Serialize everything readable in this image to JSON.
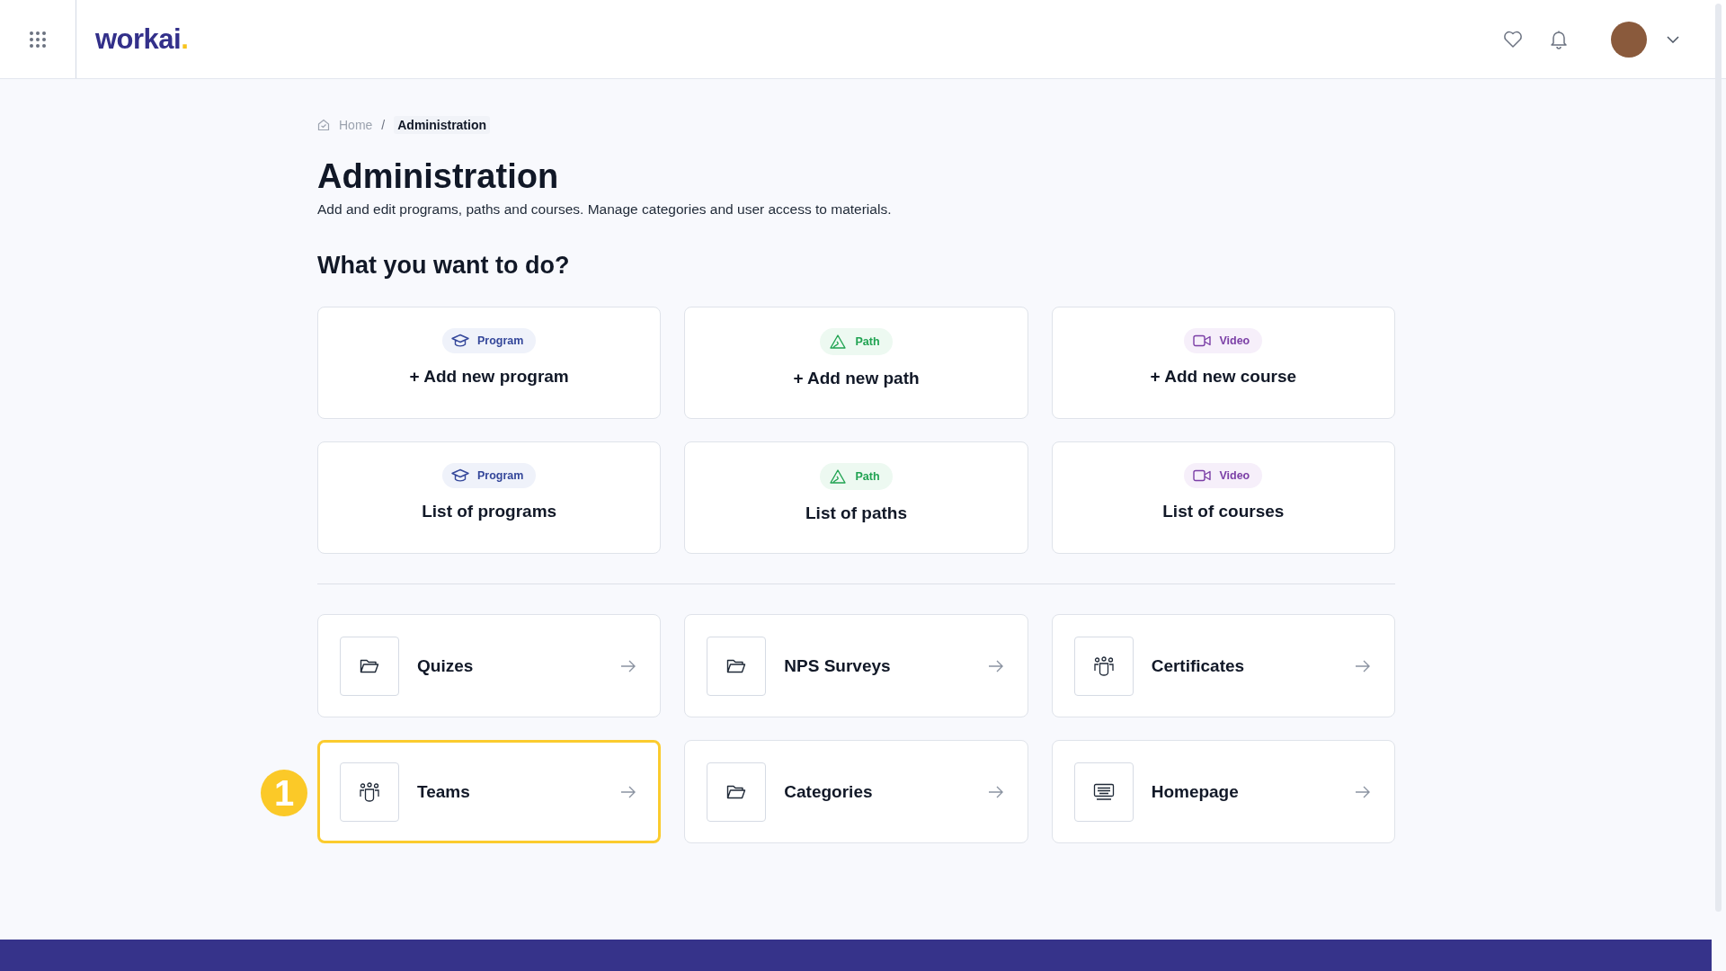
{
  "header": {
    "logo": {
      "text": "workai",
      "dot": "."
    }
  },
  "breadcrumb": {
    "separator": "/",
    "items": [
      {
        "label": "Home",
        "current": false
      },
      {
        "label": "Administration",
        "current": true
      }
    ]
  },
  "title": "Administration",
  "description": "Add and edit programs, paths and courses. Manage categories and user access to materials.",
  "section_heading": "What you want to do?",
  "content_cards": [
    {
      "badge": {
        "kind": "program",
        "label": "Program"
      },
      "title": "+ Add new program"
    },
    {
      "badge": {
        "kind": "path",
        "label": "Path"
      },
      "title": "+ Add new path"
    },
    {
      "badge": {
        "kind": "video",
        "label": "Video"
      },
      "title": "+ Add new course"
    },
    {
      "badge": {
        "kind": "program",
        "label": "Program"
      },
      "title": "List of programs"
    },
    {
      "badge": {
        "kind": "path",
        "label": "Path"
      },
      "title": "List of paths"
    },
    {
      "badge": {
        "kind": "video",
        "label": "Video"
      },
      "title": "List of courses"
    }
  ],
  "tool_cards": [
    {
      "kind": "folder",
      "label": "Quizes",
      "selected": false
    },
    {
      "kind": "folder",
      "label": "NPS Surveys",
      "selected": false
    },
    {
      "kind": "people",
      "label": "Certificates",
      "selected": false
    },
    {
      "kind": "people",
      "label": "Teams",
      "selected": true,
      "callout": "1"
    },
    {
      "kind": "folder",
      "label": "Categories",
      "selected": false
    },
    {
      "kind": "keyboard",
      "label": "Homepage",
      "selected": false
    }
  ]
}
